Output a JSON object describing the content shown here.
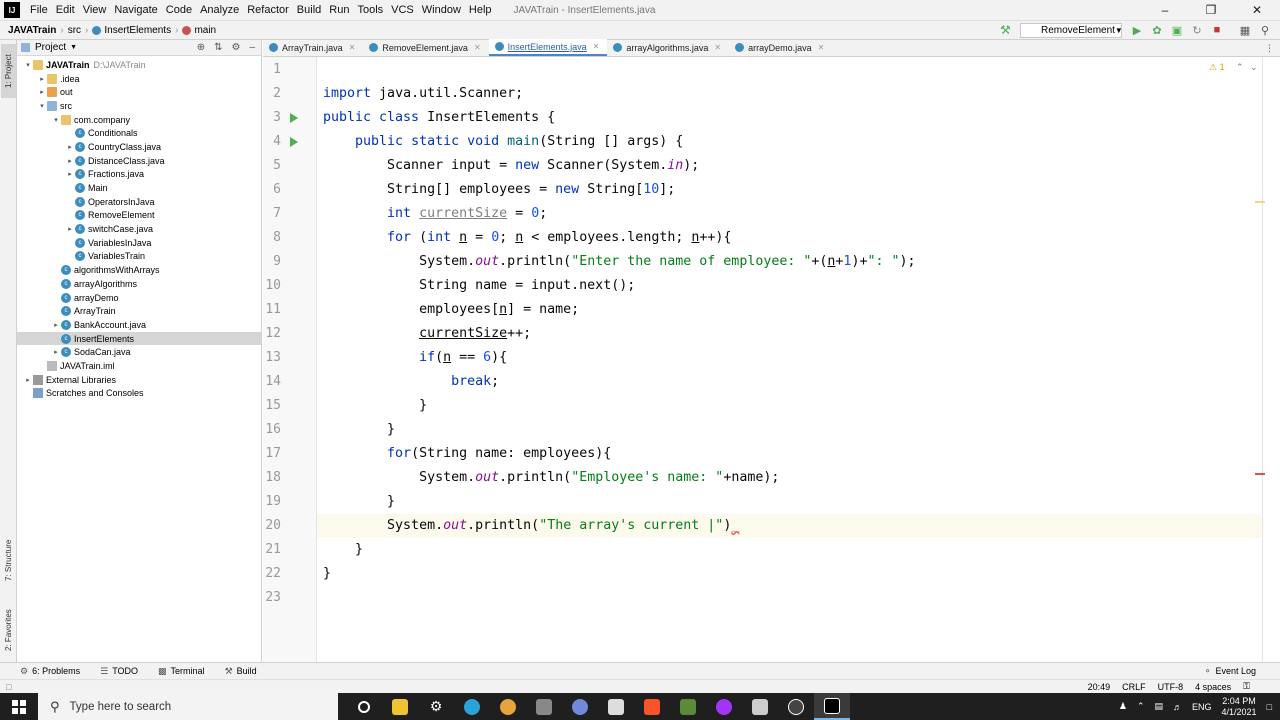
{
  "menubar": {
    "items": [
      "File",
      "Edit",
      "View",
      "Navigate",
      "Code",
      "Analyze",
      "Refactor",
      "Build",
      "Run",
      "Tools",
      "VCS",
      "Window",
      "Help"
    ],
    "window_title": "JAVATrain - InsertElements.java"
  },
  "navbar": {
    "project": "JAVATrain",
    "src": "src",
    "class": "InsertElements",
    "method": "main",
    "run_config": "RemoveElement"
  },
  "left_strip": {
    "project_tab": "1: Project",
    "structure_tab": "7: Structure",
    "favorites_tab": "2: Favorites"
  },
  "project_panel": {
    "title": "Project",
    "tree": [
      {
        "label": "JAVATrain",
        "path": "D:\\JAVATrain",
        "depth": 0,
        "kind": "folder"
      },
      {
        "label": ".idea",
        "depth": 1,
        "kind": "folder"
      },
      {
        "label": "out",
        "depth": 1,
        "kind": "folder-orange"
      },
      {
        "label": "src",
        "depth": 1,
        "kind": "folder-blue"
      },
      {
        "label": "com.company",
        "depth": 2,
        "kind": "folder"
      },
      {
        "label": "Conditionals",
        "depth": 3,
        "kind": "class"
      },
      {
        "label": "CountryClass.java",
        "depth": 3,
        "kind": "class"
      },
      {
        "label": "DistanceClass.java",
        "depth": 3,
        "kind": "class"
      },
      {
        "label": "Fractions.java",
        "depth": 3,
        "kind": "class"
      },
      {
        "label": "Main",
        "depth": 3,
        "kind": "class"
      },
      {
        "label": "OperatorsInJava",
        "depth": 3,
        "kind": "class"
      },
      {
        "label": "RemoveElement",
        "depth": 3,
        "kind": "class"
      },
      {
        "label": "switchCase.java",
        "depth": 3,
        "kind": "class"
      },
      {
        "label": "VariablesInJava",
        "depth": 3,
        "kind": "class"
      },
      {
        "label": "VariablesTrain",
        "depth": 3,
        "kind": "class"
      },
      {
        "label": "algorithmsWithArrays",
        "depth": 2,
        "kind": "class"
      },
      {
        "label": "arrayAlgorithms",
        "depth": 2,
        "kind": "class"
      },
      {
        "label": "arrayDemo",
        "depth": 2,
        "kind": "class"
      },
      {
        "label": "ArrayTrain",
        "depth": 2,
        "kind": "class"
      },
      {
        "label": "BankAccount.java",
        "depth": 2,
        "kind": "class"
      },
      {
        "label": "InsertElements",
        "depth": 2,
        "kind": "class",
        "selected": true
      },
      {
        "label": "SodaCan.java",
        "depth": 2,
        "kind": "class"
      },
      {
        "label": "JAVATrain.iml",
        "depth": 1,
        "kind": "file"
      },
      {
        "label": "External Libraries",
        "depth": 0,
        "kind": "lib"
      },
      {
        "label": "Scratches and Consoles",
        "depth": 0,
        "kind": "scratch"
      }
    ]
  },
  "editor_tabs": [
    {
      "label": "ArrayTrain.java"
    },
    {
      "label": "RemoveElement.java"
    },
    {
      "label": "InsertElements.java",
      "active": true
    },
    {
      "label": "arrayAlgorithms.java"
    },
    {
      "label": "arrayDemo.java"
    }
  ],
  "editor": {
    "warning_count": "1",
    "line_numbers": [
      "1",
      "2",
      "3",
      "4",
      "5",
      "6",
      "7",
      "8",
      "9",
      "10",
      "11",
      "12",
      "13",
      "14",
      "15",
      "16",
      "17",
      "18",
      "19",
      "20",
      "21",
      "22",
      "23"
    ]
  },
  "bottom_tools": {
    "problems": "6: Problems",
    "todo": "TODO",
    "terminal": "Terminal",
    "build": "Build",
    "event_log": "Event Log"
  },
  "statusbar": {
    "position": "20:49",
    "line_sep": "CRLF",
    "encoding": "UTF-8",
    "indent": "4 spaces"
  },
  "taskbar": {
    "search_placeholder": "Type here to search",
    "lang": "ENG",
    "time": "2:04 PM",
    "date": "4/1/2021"
  }
}
